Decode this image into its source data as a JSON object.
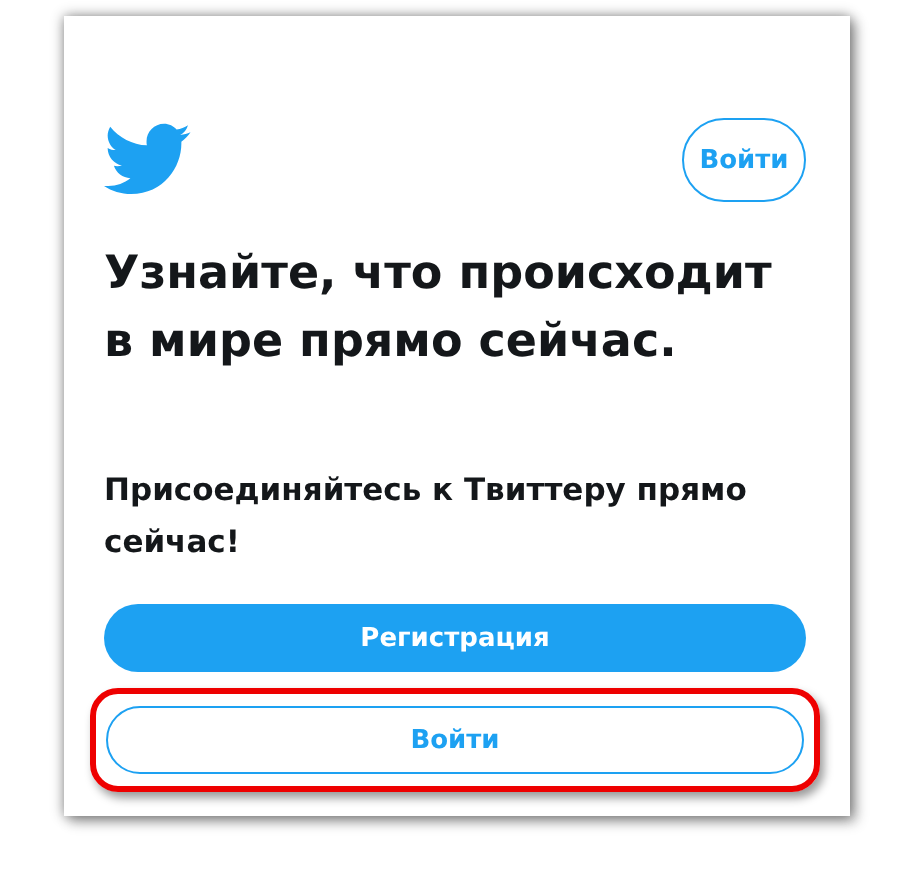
{
  "header": {
    "login_button": "Войти"
  },
  "headline": "Узнайте, что происходит в мире прямо сейчас.",
  "subtitle": "Присоединяйтесь к Твиттеру прямо сейчас!",
  "buttons": [
    {
      "label": "Регистрация",
      "kind": "filled",
      "highlighted": false
    },
    {
      "label": "Войти",
      "kind": "outline",
      "highlighted": true
    }
  ]
}
